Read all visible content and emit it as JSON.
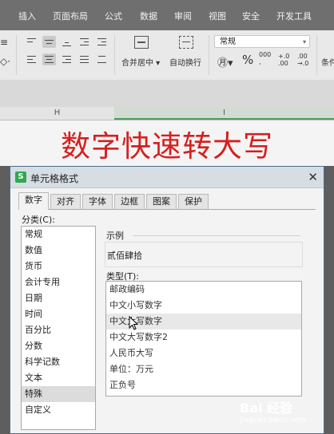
{
  "ribbon": {
    "tabs": [
      "插入",
      "页面布局",
      "公式",
      "数据",
      "审阅",
      "视图",
      "安全",
      "开发工具"
    ],
    "merge_label": "合并居中",
    "wrap_label": "自动换行",
    "number_format": "常规",
    "percent_symbol": "%",
    "thousands_symbol": "000",
    "dec_inc": "+.0",
    "dec_dec": ".00",
    "partial_label": "条",
    "partial_label2": "条件"
  },
  "sheet": {
    "col_h": "H",
    "col_i": "I"
  },
  "banner": {
    "text": "数字快速转大写"
  },
  "dialog": {
    "title": "单元格格式",
    "close_glyph": "✕",
    "app_icon": "S",
    "tabs": [
      "数字",
      "对齐",
      "字体",
      "边框",
      "图案",
      "保护"
    ],
    "category_label": "分类(C):",
    "categories": [
      "常规",
      "数值",
      "货币",
      "会计专用",
      "日期",
      "时间",
      "百分比",
      "分数",
      "科学记数",
      "文本",
      "特殊",
      "自定义"
    ],
    "selected_category": "特殊",
    "sample_label": "示例",
    "sample_value": "贰佰肆拾",
    "type_label": "类型(T):",
    "types": [
      "邮政编码",
      "中文小写数字",
      "中文大写数字",
      "中文大写数字2",
      "人民币大写",
      "单位：万元",
      "正负号"
    ],
    "hovered_type": "中文大写数字"
  },
  "watermark": {
    "brand": "Bai 经验",
    "url": "jingyan.baidu.com"
  },
  "colors": {
    "banner_text": "#d42020",
    "dialog_border": "#4f6e88",
    "app_icon": "#2fa84f"
  }
}
